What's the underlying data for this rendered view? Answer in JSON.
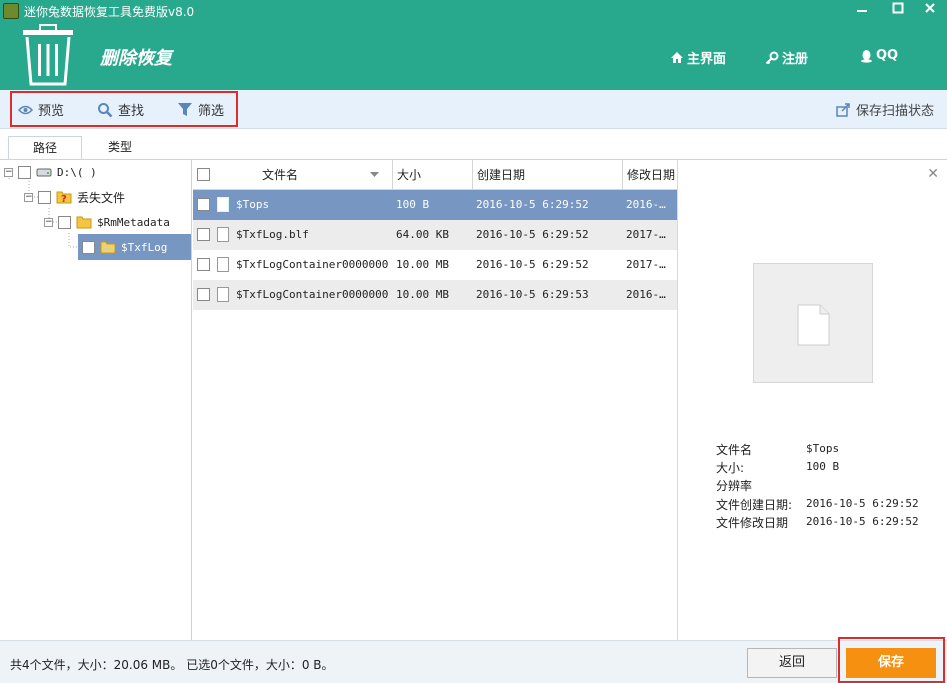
{
  "window": {
    "title": "迷你兔数据恢复工具免费版v8.0",
    "minimize_icon": "minimize-icon",
    "maximize_icon": "maximize-icon",
    "close_icon": "close-icon"
  },
  "header": {
    "mode_title": "删除恢复",
    "mode_icon": "trash-icon",
    "nav": [
      {
        "label": "主界面",
        "icon": "home-icon"
      },
      {
        "label": "注册",
        "icon": "key-icon"
      },
      {
        "label": "QQ",
        "icon": "qq-icon"
      }
    ]
  },
  "toolbar": {
    "preview_label": "预览",
    "find_label": "查找",
    "filter_label": "筛选",
    "save_scan_label": "保存扫描状态"
  },
  "tabs": {
    "path": "路径",
    "type": "类型",
    "active": "path"
  },
  "tree": {
    "drive": "D:\\(        )",
    "lost_files": "丢失文件",
    "metadata": "$RmMetadata",
    "txflog": "$TxfLog"
  },
  "file_list": {
    "columns": [
      "文件名",
      "大小",
      "创建日期",
      "修改日期"
    ],
    "rows": [
      {
        "name": "$Tops",
        "size": "100 B",
        "created": "2016-10-5 6:29:52",
        "modified": "2016-…",
        "selected": true
      },
      {
        "name": "$TxfLog.blf",
        "size": "64.00 KB",
        "created": "2016-10-5 6:29:52",
        "modified": "2017-…",
        "selected": false
      },
      {
        "name": "$TxfLogContainer0000000…",
        "size": "10.00 MB",
        "created": "2016-10-5 6:29:52",
        "modified": "2017-…",
        "selected": false
      },
      {
        "name": "$TxfLogContainer0000000…",
        "size": "10.00 MB",
        "created": "2016-10-5 6:29:53",
        "modified": "2016-…",
        "selected": false
      }
    ]
  },
  "preview": {
    "labels": {
      "name": "文件名",
      "size": "大小:",
      "resolution": "分辨率",
      "created": "文件创建日期:",
      "modified": "文件修改日期"
    },
    "values": {
      "name": "$Tops",
      "size": "100 B",
      "resolution": "",
      "created": "2016-10-5 6:29:52",
      "modified": "2016-10-5 6:29:52"
    }
  },
  "status": {
    "text": "共4个文件，大小：20.06 MB。 已选0个文件，大小：0 B。"
  },
  "buttons": {
    "back": "返回",
    "save": "保存"
  },
  "colors": {
    "header_green": "#28a88c",
    "selected_row": "#7796c1",
    "save_orange": "#f59011",
    "highlight_red": "#e02b2b"
  }
}
